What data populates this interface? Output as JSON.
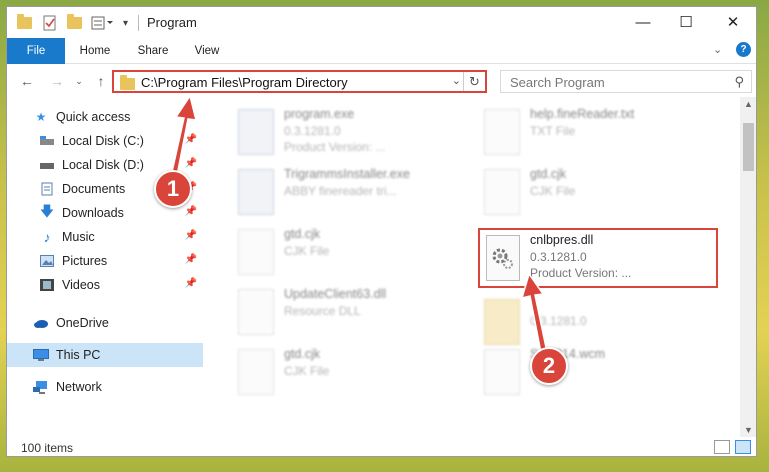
{
  "window": {
    "title": "Program"
  },
  "ribbon": {
    "tabs": [
      "File",
      "Home",
      "Share",
      "View"
    ]
  },
  "address": {
    "path": "C:\\Program Files\\Program Directory"
  },
  "search": {
    "placeholder": "Search Program"
  },
  "nav": {
    "items": [
      {
        "label": "Quick access",
        "icon": "star-icon",
        "pinned": false
      },
      {
        "label": "Local Disk (C:)",
        "icon": "drive-icon",
        "pinned": true
      },
      {
        "label": "Local Disk (D:)",
        "icon": "drive-icon",
        "pinned": true
      },
      {
        "label": "Documents",
        "icon": "documents-icon",
        "pinned": true
      },
      {
        "label": "Downloads",
        "icon": "download-icon",
        "pinned": true
      },
      {
        "label": "Music",
        "icon": "music-icon",
        "pinned": true
      },
      {
        "label": "Pictures",
        "icon": "pictures-icon",
        "pinned": true
      },
      {
        "label": "Videos",
        "icon": "videos-icon",
        "pinned": true
      },
      {
        "label": "OneDrive",
        "icon": "cloud-icon",
        "pinned": false
      },
      {
        "label": "This PC",
        "icon": "computer-icon",
        "pinned": false,
        "selected": true
      },
      {
        "label": "Network",
        "icon": "network-icon",
        "pinned": false
      }
    ]
  },
  "files": [
    {
      "name": "program.exe",
      "line2": "0.3.1281.0",
      "line3": "Product Version: ..."
    },
    {
      "name": "help.fineReader.txt",
      "line2": "TXT File",
      "line3": ""
    },
    {
      "name": "TrigrammsInstaller.exe",
      "line2": "ABBY finereader tri...",
      "line3": ""
    },
    {
      "name": "gtd.cjk",
      "line2": "CJK File",
      "line3": ""
    },
    {
      "name": "gtd.cjk",
      "line2": "CJK File",
      "line3": ""
    },
    {
      "name": "cnlbpres.dll",
      "line2": "0.3.1281.0",
      "line3": "Product Version:      ..."
    },
    {
      "name": "UpdateClient63.dll",
      "line2": "Resource DLL",
      "line3": ""
    },
    {
      "name": "",
      "line2": "0.3.1281.0",
      "line3": ""
    },
    {
      "name": "gtd.cjk",
      "line2": "CJK File",
      "line3": ""
    },
    {
      "name": "S    WP14.wcm",
      "line2": "",
      "line3": ""
    }
  ],
  "status": {
    "count": "100 items"
  },
  "annotations": [
    "1",
    "2"
  ],
  "colors": {
    "accent": "#1979ca",
    "highlight": "#d9453a",
    "selected": "#cce4f7"
  }
}
